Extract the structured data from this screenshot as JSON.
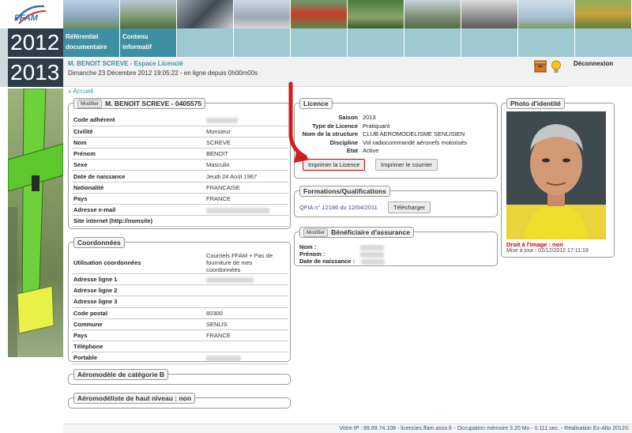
{
  "header": {
    "logo_text": "FFAM",
    "nav": [
      {
        "label": "Référentiel documentaire"
      },
      {
        "label": "Contenu informatif"
      },
      {
        "label": ""
      },
      {
        "label": ""
      },
      {
        "label": ""
      },
      {
        "label": ""
      },
      {
        "label": ""
      },
      {
        "label": ""
      },
      {
        "label": ""
      },
      {
        "label": ""
      }
    ],
    "year1": "2012",
    "year2": "2013",
    "user_line": "M. BENOIT SCREVE - Espace Licencié",
    "date_line": "Dimanche 23 Décembre 2012 19:05:22 - en ligne depuis 0h00m00s",
    "logout": "Déconnexion"
  },
  "breadcrumb": "» Accueil",
  "identity": {
    "modify_label": "Modifier",
    "title": "M. BENOIT SCREVE - 0405575",
    "rows": [
      {
        "k": "Code adhérent",
        "v": "",
        "blur": true,
        "w": 40
      },
      {
        "k": "Civilité",
        "v": "Monsieur"
      },
      {
        "k": "Nom",
        "v": "SCREVE"
      },
      {
        "k": "Prénom",
        "v": "BENOIT"
      },
      {
        "k": "Sexe",
        "v": "Masculin"
      },
      {
        "k": "Date de naissance",
        "v": "Jeudi 24 Août 1967"
      },
      {
        "k": "Nationalité",
        "v": "FRANCAISE"
      },
      {
        "k": "Pays",
        "v": "FRANCE"
      },
      {
        "k": "Adresse e-mail",
        "v": "",
        "blur": true,
        "w": 80
      },
      {
        "k": "Site internet (http://nomsite)",
        "v": ""
      }
    ]
  },
  "coordonnees": {
    "title": "Coordonnées",
    "rows": [
      {
        "k": "Utilisation coordonnées",
        "v": "Courriels FFAM + Pas de fourniture de mes coordonnées"
      },
      {
        "k": "Adresse ligne 1",
        "v": "",
        "blur": true,
        "w": 60
      },
      {
        "k": "Adresse ligne 2",
        "v": ""
      },
      {
        "k": "Adresse ligne 3",
        "v": ""
      },
      {
        "k": "Code postal",
        "v": "60300"
      },
      {
        "k": "Commune",
        "v": "SENLIS"
      },
      {
        "k": "Pays",
        "v": "FRANCE"
      },
      {
        "k": "Téléphone",
        "v": ""
      },
      {
        "k": "Portable",
        "v": "",
        "blur": true,
        "w": 44
      }
    ]
  },
  "aero_b": {
    "title": "Aéromodèle de catégorie B"
  },
  "aero_haut": {
    "title": "Aéromodéliste de haut niveau : non"
  },
  "licence": {
    "title": "Licence",
    "rows": [
      {
        "k": "Saison",
        "v": "2013"
      },
      {
        "k": "Type de Licence",
        "v": "Pratiquant"
      },
      {
        "k": "Nom de la structure",
        "v": "CLUB AEROMODELISME SENLISIEN"
      },
      {
        "k": "Discipline",
        "v": "Vol radiocommandé aéronefs motorisés"
      },
      {
        "k": "Etat",
        "v": "Active"
      }
    ],
    "print_licence": "Imprimer la Licence",
    "print_courrier": "Imprimer le courrier"
  },
  "formations": {
    "title": "Formations/Qualifications",
    "item": "QFIA n° 12186 du 12/04/2011",
    "download": "Télécharger"
  },
  "assurance": {
    "modify_label": "Modifier",
    "title": "Bénéficiaire d'assurance",
    "rows": [
      {
        "k": "Nom :"
      },
      {
        "k": "Prénom :"
      },
      {
        "k": "Date de naissance :"
      }
    ]
  },
  "photo": {
    "title": "Photo d'identité",
    "droit": "Droit à l'image : non",
    "maj": "Mise à jour : 02/12/2012 17:11:19"
  },
  "footer": "Votre IP : 89.89.74.108 - licencies.ffam.asso.fr - Occupation mémoire 3.20 Mo - 0.111 sec. - Réalisation Ex-Alto 2012©",
  "colors": {
    "accent": "#3d8fa1",
    "nav": "#9ec9d1",
    "year_bg": "#2f3c47",
    "warn": "#cc0000",
    "link": "#334d8c"
  }
}
